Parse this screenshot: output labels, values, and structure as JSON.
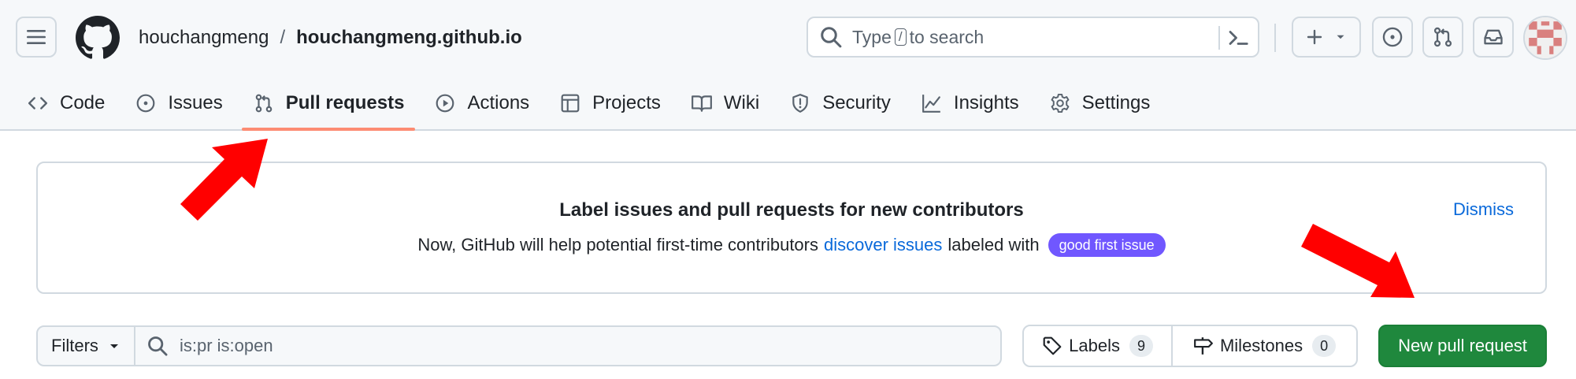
{
  "header": {
    "owner": "houchangmeng",
    "separator": "/",
    "repo": "houchangmeng.github.io",
    "search": {
      "prefix": "Type",
      "key": "/",
      "suffix": "to search"
    }
  },
  "nav": {
    "tabs": [
      {
        "label": "Code",
        "icon": "code-icon"
      },
      {
        "label": "Issues",
        "icon": "issue-icon"
      },
      {
        "label": "Pull requests",
        "icon": "pull-request-icon",
        "active": true
      },
      {
        "label": "Actions",
        "icon": "play-icon"
      },
      {
        "label": "Projects",
        "icon": "table-icon"
      },
      {
        "label": "Wiki",
        "icon": "book-icon"
      },
      {
        "label": "Security",
        "icon": "shield-icon"
      },
      {
        "label": "Insights",
        "icon": "graph-icon"
      },
      {
        "label": "Settings",
        "icon": "gear-icon"
      }
    ],
    "active_underline_color": "#fd8c73"
  },
  "banner": {
    "title": "Label issues and pull requests for new contributors",
    "text_before": "Now, GitHub will help potential first-time contributors",
    "link": "discover issues",
    "text_after": "labeled with",
    "label": "good first issue",
    "label_color": "#7057ff",
    "dismiss": "Dismiss"
  },
  "toolbar": {
    "filters_label": "Filters",
    "filter_value": "is:pr is:open",
    "labels_label": "Labels",
    "labels_count": "9",
    "milestones_label": "Milestones",
    "milestones_count": "0",
    "new_pr_label": "New pull request",
    "new_pr_color": "#1f883d"
  },
  "annotations": {
    "arrow_color": "#ff0000"
  }
}
